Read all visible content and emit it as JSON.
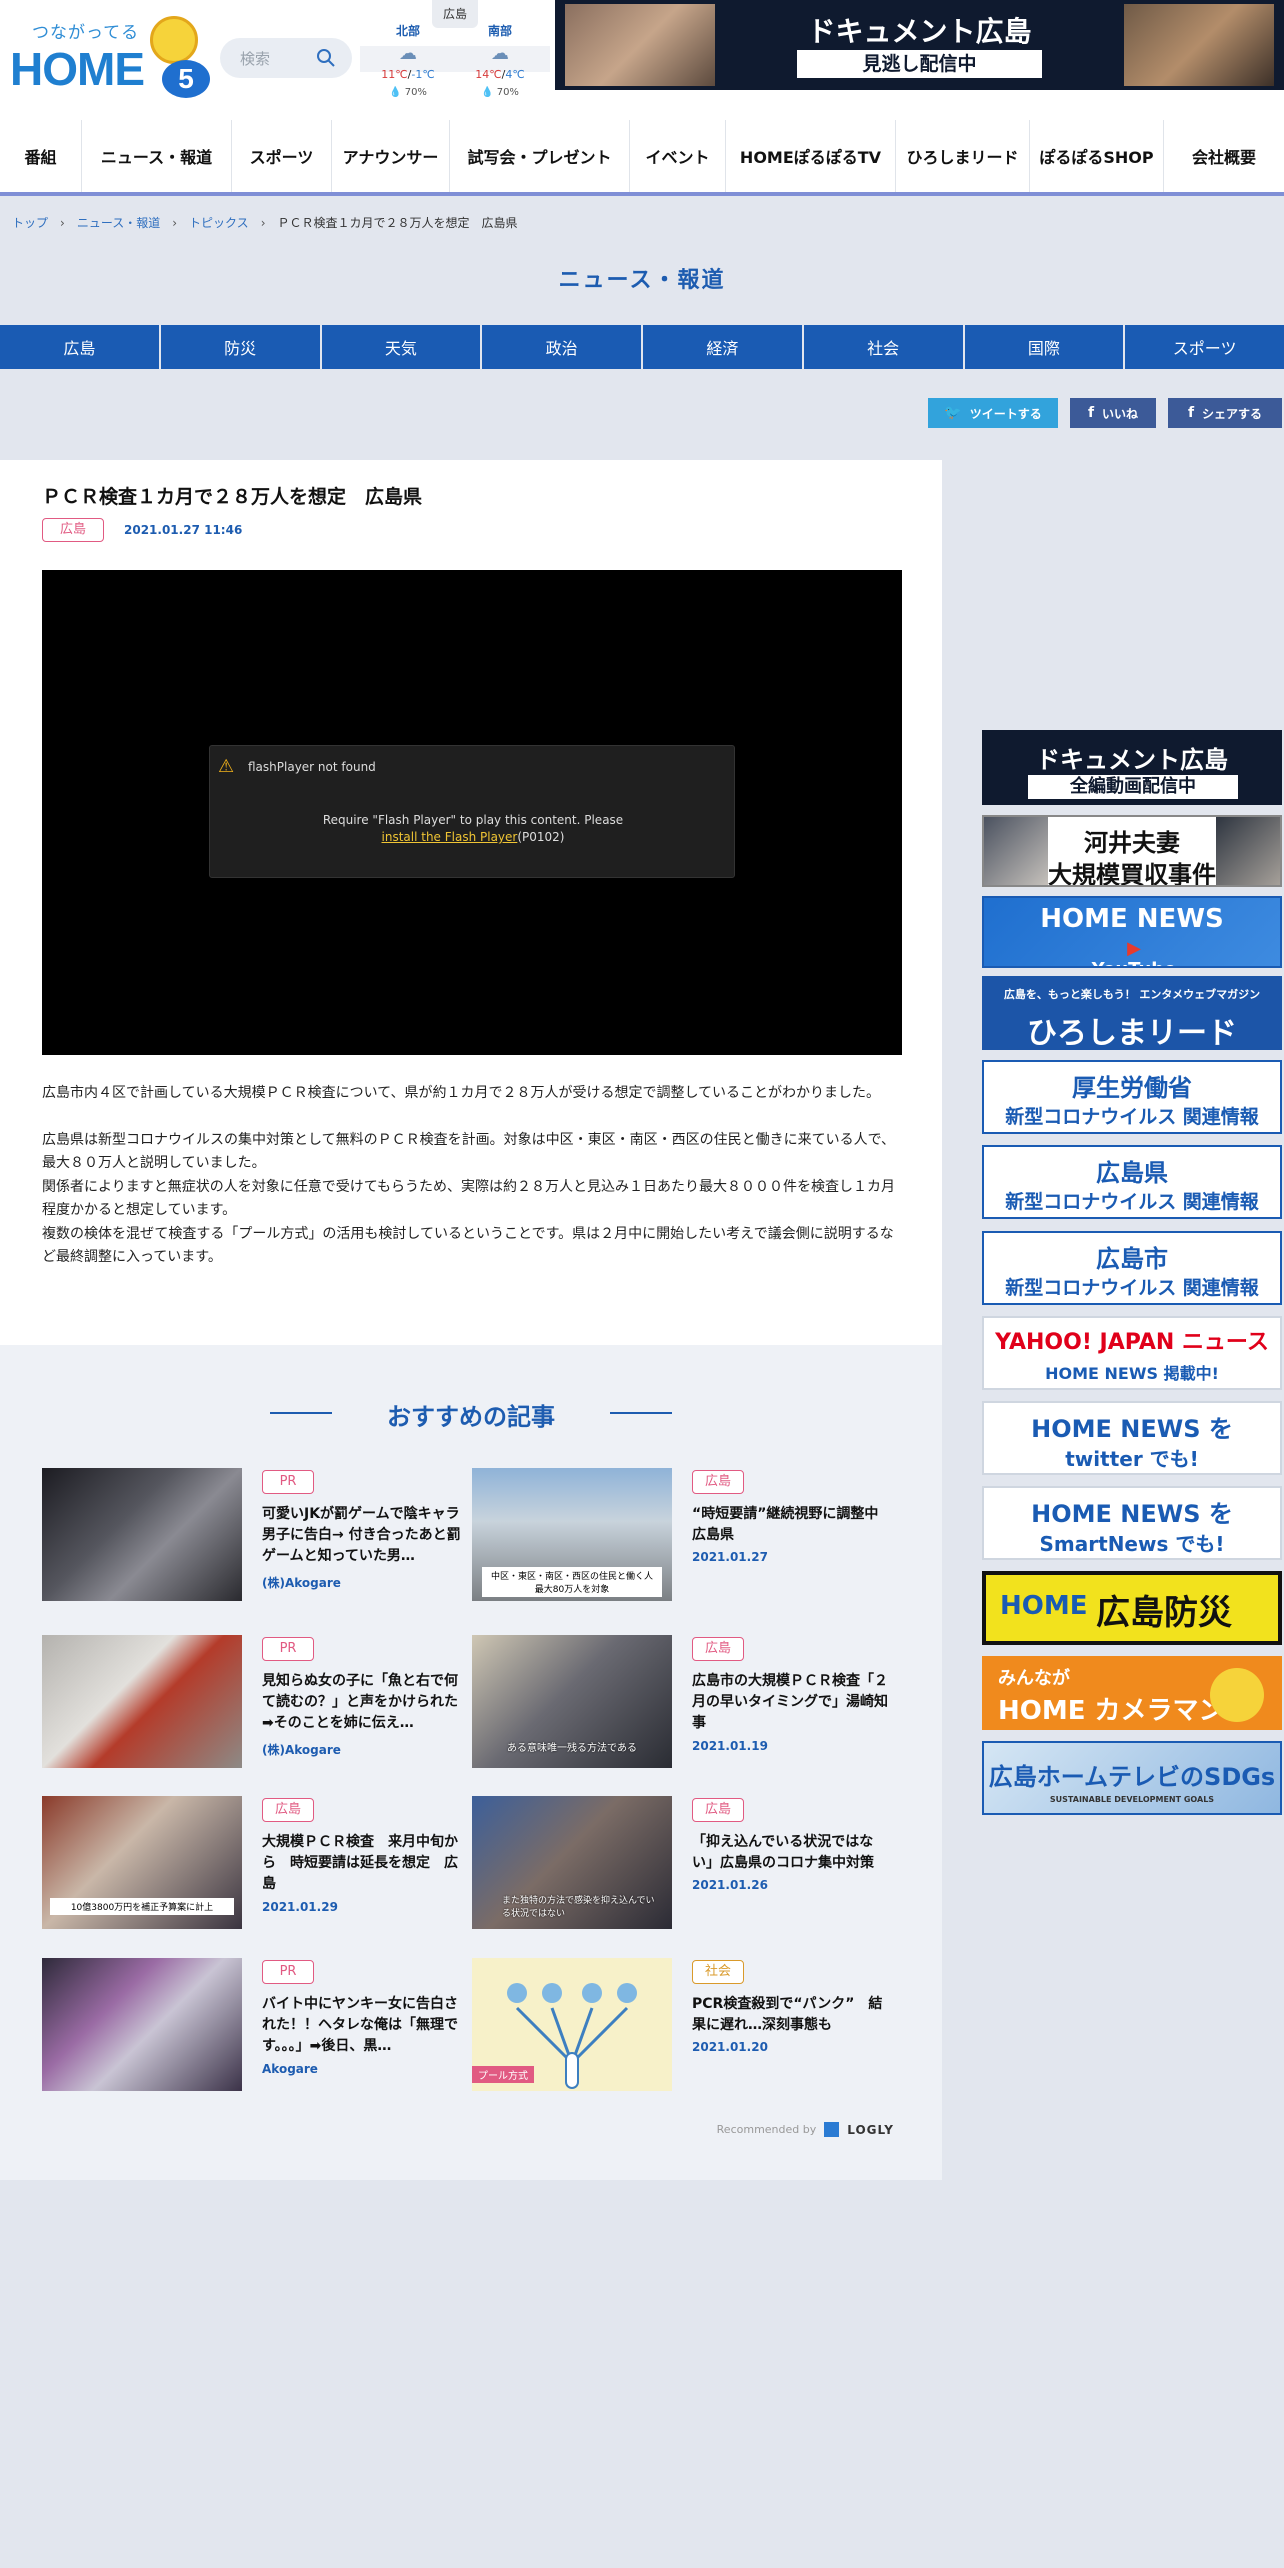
{
  "header": {
    "logo_tagline": "つながってる",
    "logo_word": "HOME",
    "logo_five": "5",
    "search_placeholder": "検索",
    "weather": {
      "pref": "広島",
      "areas": [
        {
          "name": "北部",
          "hi": "11℃",
          "lo": "-1℃",
          "rain": "70%"
        },
        {
          "name": "南部",
          "hi": "14℃",
          "lo": "4℃",
          "rain": "70%"
        }
      ]
    },
    "banner": {
      "title": "ドキュメント広島",
      "sub": "見逃し配信中"
    }
  },
  "nav": [
    "番組",
    "ニュース・報道",
    "スポーツ",
    "アナウンサー",
    "試写会・プレゼント",
    "イベント",
    "HOMEぽるぽるTV",
    "ひろしまリード",
    "ぽるぽるSHOP",
    "会社概要"
  ],
  "breadcrumb": [
    "トップ",
    "ニュース・報道",
    "トピックス",
    "ＰＣＲ検査１カ月で２８万人を想定　広島県"
  ],
  "section_title": "ニュース・報道",
  "categories": [
    "広島",
    "防災",
    "天気",
    "政治",
    "経済",
    "社会",
    "国際",
    "スポーツ"
  ],
  "share": {
    "tweet": "ツイートする",
    "like": "いいね",
    "share": "シェアする"
  },
  "article": {
    "title": "ＰＣＲ検査１カ月で２８万人を想定　広島県",
    "tag": "広島",
    "date": "2021.01.27 11:46",
    "player": {
      "header": "flashPlayer not found",
      "msg1": "Require \"Flash Player\" to play this content. Please",
      "link": "install the Flash Player",
      "code": "(P0102)"
    },
    "paragraphs": [
      "広島市内４区で計画している大規模ＰＣＲ検査について、県が約１カ月で２８万人が受ける想定で調整していることがわかりました。",
      "広島県は新型コロナウイルスの集中対策として無料のＰＣＲ検査を計画。対象は中区・東区・南区・西区の住民と働きに来ている人で、最大８０万人と説明していました。",
      "関係者によりますと無症状の人を対象に任意で受けてもらうため、実際は約２８万人と見込み１日あたり最大８０００件を検査し１カ月程度かかると想定しています。",
      "複数の検体を混ぜて検査する「プール方式」の活用も検討しているということです。県は２月中に開始したい考えで議会側に説明するなど最終調整に入っています。"
    ]
  },
  "recommend": {
    "title": "おすすめの記事",
    "cards": [
      {
        "tag": "PR",
        "title": "可愛いJKが罰ゲームで陰キャラ男子に告白→ 付き合ったあと罰ゲームと知っていた男…",
        "meta": "(株)Akogare"
      },
      {
        "tag": "広島",
        "title": "“時短要請”継続視野に調整中　広島県",
        "meta": "2021.01.27"
      },
      {
        "tag": "PR",
        "title": "見知らぬ女の子に「魚と右で何て読むの？」と声をかけられた➡そのことを姉に伝え…",
        "meta": "(株)Akogare"
      },
      {
        "tag": "広島",
        "title": "広島市の大規模ＰＣＲ検査「２月の早いタイミングで」湯崎知事",
        "meta": "2021.01.19"
      },
      {
        "tag": "広島",
        "title": "大規模ＰＣＲ検査　来月中旬から　時短要請は延長を想定　広島",
        "meta": "2021.01.29"
      },
      {
        "tag": "広島",
        "title": "「抑え込んでいる状況ではない」広島県のコロナ集中対策",
        "meta": "2021.01.26"
      },
      {
        "tag": "PR",
        "title": "バイト中にヤンキー女に告白された！！ヘタレな俺は「無理です。。。」➡後日、黒…",
        "meta": "Akogare"
      },
      {
        "tag": "社会",
        "title": "PCR検査殺到で“パンク”　結果に遅れ…深刻事態も",
        "meta": "2021.01.20"
      }
    ],
    "thumb_captions": [
      "",
      "中区・東区・南区・西区の住民と働く人　最大80万人を対象",
      "",
      "ある意味唯一残る方法である",
      "10億3800万円を補正予算案に計上",
      "また独特の方法で感染を抑え込んでいる状況ではない",
      "",
      "プール方式"
    ],
    "recommended_by": "Recommended by",
    "logly": "LOGLY"
  },
  "sidebar": [
    {
      "l1": "ドキュメント広島",
      "l2": "全編動画配信中"
    },
    {
      "l1": "河井夫妻",
      "l2": "大規模買収事件"
    },
    {
      "l1": "HOME NEWS",
      "l2": "YouTube"
    },
    {
      "l1": "広島を、もっと楽しもう！ エンタメウェブマガジン",
      "l2": "ひろしまリード"
    },
    {
      "l1": "厚生労働省",
      "l2": "新型コロナウイルス 関連情報"
    },
    {
      "l1": "広島県",
      "l2": "新型コロナウイルス 関連情報"
    },
    {
      "l1": "広島市",
      "l2": "新型コロナウイルス 関連情報"
    },
    {
      "l1": "YAHOO! JAPAN ニュース",
      "l2": "HOME NEWS 掲載中!"
    },
    {
      "l1": "HOME NEWS を",
      "l2": "twitter でも!"
    },
    {
      "l1": "HOME NEWS を",
      "l2": "SmartNews でも!"
    },
    {
      "l1": "HOME",
      "l2": "広島防災"
    },
    {
      "l1": "みんなが",
      "l2": "HOME カメラマン"
    },
    {
      "l1": "広島ホームテレビのSDGs",
      "l2": "SUSTAINABLE DEVELOPMENT GOALS"
    }
  ]
}
